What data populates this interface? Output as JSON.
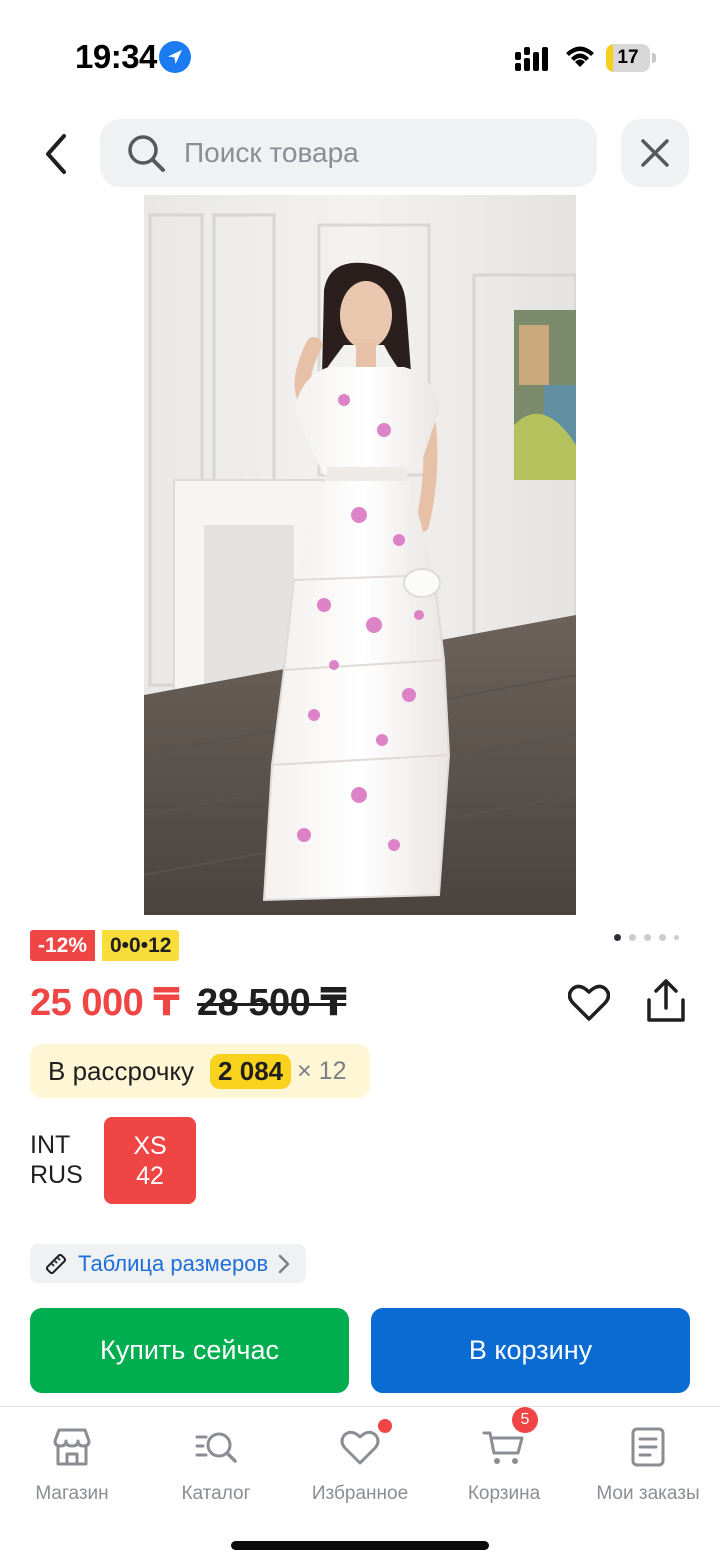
{
  "status_bar": {
    "time": "19:34",
    "battery_percent": "17",
    "battery_level": 0.17,
    "icons": [
      "location-arrow-icon",
      "cellular-signal-icon",
      "wifi-icon",
      "battery-icon"
    ]
  },
  "header": {
    "back_icon": "chevron-left-icon",
    "search_placeholder": "Поиск товара",
    "close_icon": "close-icon"
  },
  "gallery": {
    "image_count": 5,
    "active_index": 0
  },
  "product": {
    "discount_badge": "-12%",
    "installment_badge": "0•0•12",
    "price_current": "25 000 ₸",
    "price_old": "28 500 ₸",
    "installment": {
      "label": "В рассрочку",
      "amount": "2 084",
      "months": "× 12"
    },
    "size": {
      "system_1": "INT",
      "system_2": "RUS",
      "value_1": "XS",
      "value_2": "42"
    },
    "size_table_label": "Таблица размеров"
  },
  "actions": {
    "buy_now": "Купить сейчас",
    "add_to_cart": "В корзину"
  },
  "bottom_nav": {
    "items": [
      {
        "label": "Магазин",
        "icon": "shop-icon"
      },
      {
        "label": "Каталог",
        "icon": "catalog-search-icon"
      },
      {
        "label": "Избранное",
        "icon": "heart-icon"
      },
      {
        "label": "Корзина",
        "icon": "cart-icon"
      },
      {
        "label": "Мои заказы",
        "icon": "orders-icon"
      }
    ],
    "cart_count": "5"
  },
  "colors": {
    "discount_red": "#f04545",
    "installment_yellow": "#f9d21e",
    "buy_green": "#00ad4f",
    "cart_blue": "#0a6cd2",
    "link_blue": "#1e6fd9"
  }
}
